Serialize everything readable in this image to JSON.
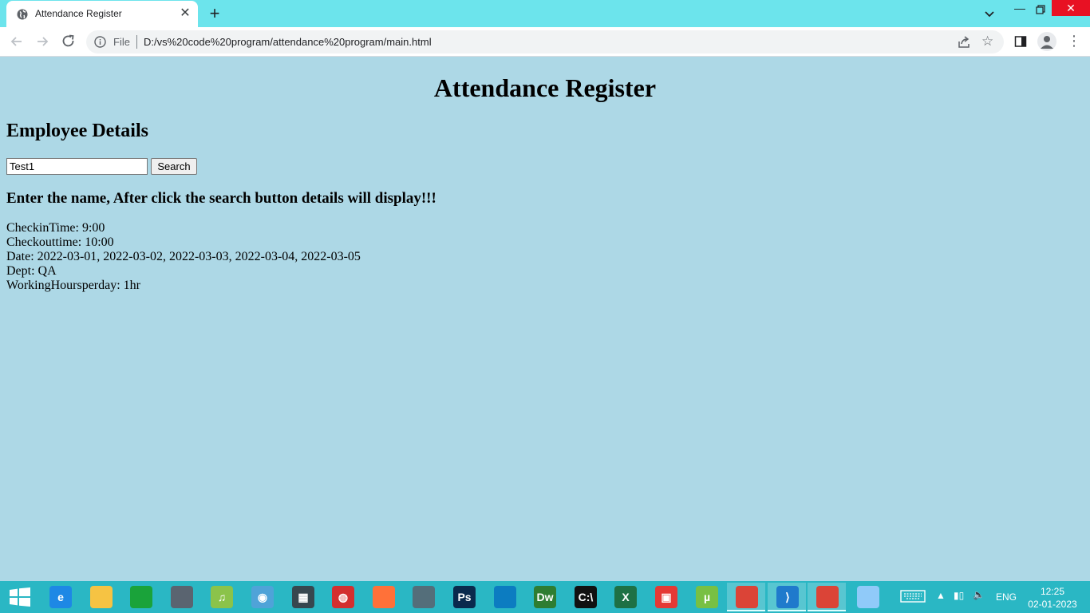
{
  "browser": {
    "tab_title": "Attendance Register",
    "new_tab_symbol": "+",
    "close_tab_symbol": "✕",
    "scheme_label": "File",
    "url": "D:/vs%20code%20program/attendance%20program/main.html"
  },
  "page": {
    "title": "Attendance Register",
    "section_heading": "Employee Details",
    "search_input_value": "Test1",
    "search_button_label": "Search",
    "instruction": "Enter the name, After click the search button details will display!!!",
    "details": [
      "CheckinTime: 9:00",
      "Checkouttime: 10:00",
      "Date: 2022-03-01, 2022-03-02, 2022-03-03, 2022-03-04, 2022-03-05",
      "Dept: QA",
      "WorkingHoursperday: 1hr"
    ]
  },
  "taskbar": {
    "apps": [
      {
        "name": "internet-explorer-icon",
        "glyph": "e",
        "color": "#1e88e5"
      },
      {
        "name": "file-explorer-icon",
        "glyph": "",
        "color": "#f6c343"
      },
      {
        "name": "store-icon",
        "glyph": "",
        "color": "#1aa33a"
      },
      {
        "name": "control-panel-icon",
        "glyph": "",
        "color": "#5a6470"
      },
      {
        "name": "music-player-icon",
        "glyph": "♫",
        "color": "#8bc34a"
      },
      {
        "name": "dvd-player-icon",
        "glyph": "◉",
        "color": "#4fa3d8"
      },
      {
        "name": "media-player-icon",
        "glyph": "▦",
        "color": "#37474f"
      },
      {
        "name": "audio-recorder-icon",
        "glyph": "◍",
        "color": "#d32f2f"
      },
      {
        "name": "firefox-icon",
        "glyph": "",
        "color": "#ff7139"
      },
      {
        "name": "laptop-app-icon",
        "glyph": "",
        "color": "#546e7a"
      },
      {
        "name": "photoshop-icon",
        "glyph": "Ps",
        "color": "#0a2a4d"
      },
      {
        "name": "edge-icon",
        "glyph": "",
        "color": "#0c7cc1"
      },
      {
        "name": "dreamweaver-icon",
        "glyph": "Dw",
        "color": "#2e7d32"
      },
      {
        "name": "command-prompt-icon",
        "glyph": "C:\\",
        "color": "#111111"
      },
      {
        "name": "excel-icon",
        "glyph": "X",
        "color": "#1e7145"
      },
      {
        "name": "remote-desktop-icon",
        "glyph": "▣",
        "color": "#e53935"
      },
      {
        "name": "utorrent-icon",
        "glyph": "µ",
        "color": "#78c043"
      },
      {
        "name": "chrome-icon",
        "glyph": "",
        "color": "#db4437"
      },
      {
        "name": "vscode-icon",
        "glyph": "⟩",
        "color": "#1f7acc"
      },
      {
        "name": "chrome-active-icon",
        "glyph": "",
        "color": "#db4437"
      },
      {
        "name": "notepad-icon",
        "glyph": "",
        "color": "#90caf9"
      }
    ],
    "language": "ENG",
    "time": "12:25",
    "date": "02-01-2023"
  }
}
